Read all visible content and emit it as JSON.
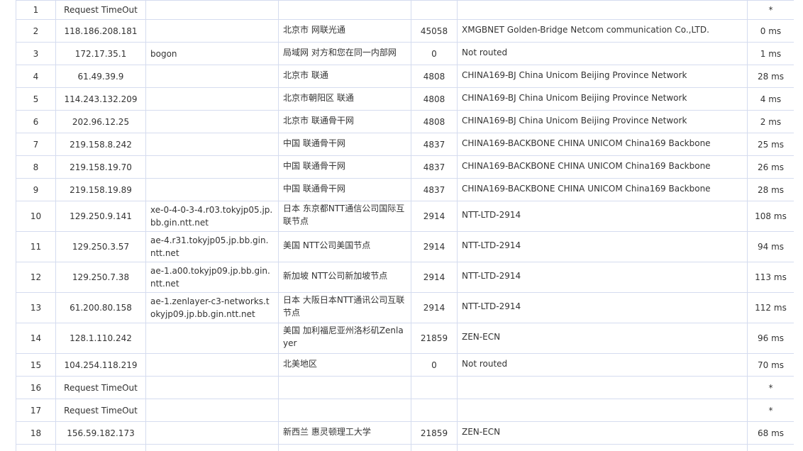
{
  "hops": [
    {
      "hop": "1",
      "ip": "Request TimeOut",
      "host": "",
      "location": "",
      "asn": "",
      "org": "",
      "time": "*"
    },
    {
      "hop": "2",
      "ip": "118.186.208.181",
      "host": "",
      "location": "北京市 网联光通",
      "asn": "45058",
      "org": "XMGBNET Golden-Bridge Netcom communication Co.,LTD.",
      "time": "0 ms"
    },
    {
      "hop": "3",
      "ip": "172.17.35.1",
      "host": "bogon",
      "location": "局域网 对方和您在同一内部网",
      "asn": "0",
      "org": "Not routed",
      "time": "1 ms"
    },
    {
      "hop": "4",
      "ip": "61.49.39.9",
      "host": "",
      "location": "北京市 联通",
      "asn": "4808",
      "org": "CHINA169-BJ China Unicom Beijing Province Network",
      "time": "28 ms"
    },
    {
      "hop": "5",
      "ip": "114.243.132.209",
      "host": "",
      "location": "北京市朝阳区 联通",
      "asn": "4808",
      "org": "CHINA169-BJ China Unicom Beijing Province Network",
      "time": "4 ms"
    },
    {
      "hop": "6",
      "ip": "202.96.12.25",
      "host": "",
      "location": "北京市 联通骨干网",
      "asn": "4808",
      "org": "CHINA169-BJ China Unicom Beijing Province Network",
      "time": "2 ms"
    },
    {
      "hop": "7",
      "ip": "219.158.8.242",
      "host": "",
      "location": "中国 联通骨干网",
      "asn": "4837",
      "org": "CHINA169-BACKBONE CHINA UNICOM China169 Backbone",
      "time": "25 ms"
    },
    {
      "hop": "8",
      "ip": "219.158.19.70",
      "host": "",
      "location": "中国 联通骨干网",
      "asn": "4837",
      "org": "CHINA169-BACKBONE CHINA UNICOM China169 Backbone",
      "time": "26 ms"
    },
    {
      "hop": "9",
      "ip": "219.158.19.89",
      "host": "",
      "location": "中国 联通骨干网",
      "asn": "4837",
      "org": "CHINA169-BACKBONE CHINA UNICOM China169 Backbone",
      "time": "28 ms"
    },
    {
      "hop": "10",
      "ip": "129.250.9.141",
      "host": "xe-0-4-0-3-4.r03.tokyjp05.jp.bb.gin.ntt.net",
      "location": "日本 东京都NTT通信公司国际互联节点",
      "asn": "2914",
      "org": "NTT-LTD-2914",
      "time": "108 ms"
    },
    {
      "hop": "11",
      "ip": "129.250.3.57",
      "host": "ae-4.r31.tokyjp05.jp.bb.gin.ntt.net",
      "location": "美国 NTT公司美国节点",
      "asn": "2914",
      "org": "NTT-LTD-2914",
      "time": "94 ms"
    },
    {
      "hop": "12",
      "ip": "129.250.7.38",
      "host": "ae-1.a00.tokyjp09.jp.bb.gin.ntt.net",
      "location": "新加坡 NTT公司新加坡节点",
      "asn": "2914",
      "org": "NTT-LTD-2914",
      "time": "113 ms"
    },
    {
      "hop": "13",
      "ip": "61.200.80.158",
      "host": "ae-1.zenlayer-c3-networks.tokyjp09.jp.bb.gin.ntt.net",
      "location": "日本 大阪日本NTT通讯公司互联节点",
      "asn": "2914",
      "org": "NTT-LTD-2914",
      "time": "112 ms"
    },
    {
      "hop": "14",
      "ip": "128.1.110.242",
      "host": "",
      "location": "美国 加利福尼亚州洛杉矶Zenlayer",
      "asn": "21859",
      "org": "ZEN-ECN",
      "time": "96 ms"
    },
    {
      "hop": "15",
      "ip": "104.254.118.219",
      "host": "",
      "location": "北美地区",
      "asn": "0",
      "org": "Not routed",
      "time": "70 ms"
    },
    {
      "hop": "16",
      "ip": "Request TimeOut",
      "host": "",
      "location": "",
      "asn": "",
      "org": "",
      "time": "*"
    },
    {
      "hop": "17",
      "ip": "Request TimeOut",
      "host": "",
      "location": "",
      "asn": "",
      "org": "",
      "time": "*"
    },
    {
      "hop": "18",
      "ip": "156.59.182.173",
      "host": "",
      "location": "新西兰 惠灵顿理工大学",
      "asn": "21859",
      "org": "ZEN-ECN",
      "time": "68 ms"
    }
  ]
}
